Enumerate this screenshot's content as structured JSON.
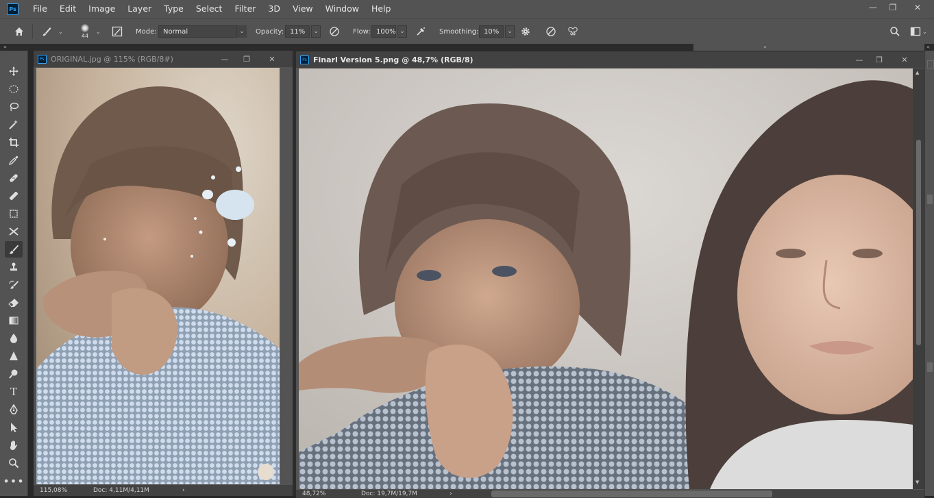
{
  "app": {
    "logo": "Ps"
  },
  "menu": [
    "File",
    "Edit",
    "Image",
    "Layer",
    "Type",
    "Select",
    "Filter",
    "3D",
    "View",
    "Window",
    "Help"
  ],
  "window_controls": {
    "minimize": "—",
    "restore": "❐",
    "close": "✕"
  },
  "options": {
    "brush_size": "44",
    "mode_label": "Mode:",
    "mode_value": "Normal",
    "opacity_label": "Opacity:",
    "opacity_value": "11%",
    "flow_label": "Flow:",
    "flow_value": "100%",
    "smoothing_label": "Smoothing:",
    "smoothing_value": "10%"
  },
  "strip": {
    "left_arrows": "»",
    "mid_arrows": "«",
    "right_arrows": "«"
  },
  "tools": [
    "move-tool-icon",
    "ellipse-marquee-icon",
    "lasso-icon",
    "magic-wand-icon",
    "crop-icon",
    "eyedropper-icon",
    "healing-brush-icon",
    "patch-icon",
    "frame-icon",
    "content-aware-move-icon",
    "brush-icon",
    "clone-stamp-icon",
    "history-brush-icon",
    "eraser-icon",
    "gradient-icon",
    "blur-icon",
    "sharpen-icon",
    "dodge-icon",
    "type-icon",
    "pen-icon",
    "path-selection-icon",
    "hand-icon",
    "zoom-icon",
    "more-tools-icon"
  ],
  "doc1": {
    "title": "ORIGINAL.jpg @ 115% (RGB/8#)",
    "zoom": "115,08%",
    "docinfo": "Doc: 4,11M/4,11M",
    "arrow": "›"
  },
  "doc2": {
    "title": "Finarl Version 5.png @ 48,7% (RGB/8)",
    "zoom": "48,72%",
    "docinfo": "Doc: 19,7M/19,7M",
    "arrow": "›"
  },
  "colors": {
    "ui_dark": "#535353",
    "ui_darker": "#424242",
    "accent": "#31a8ff"
  }
}
